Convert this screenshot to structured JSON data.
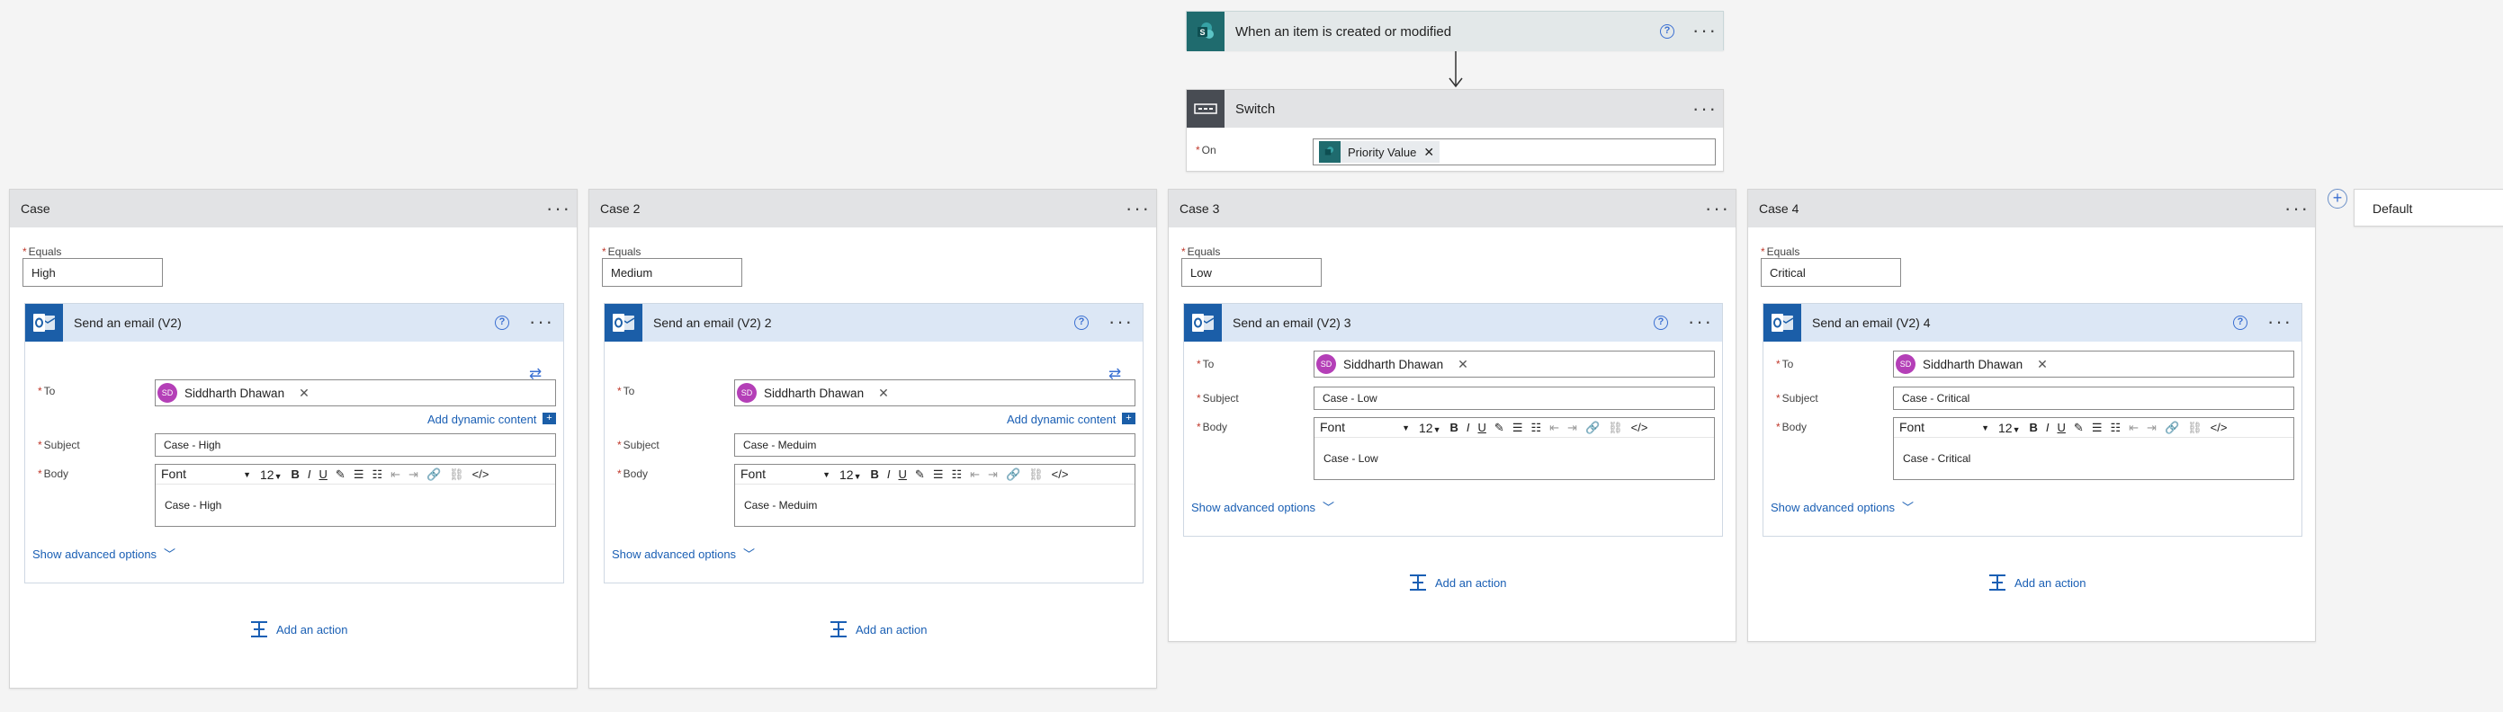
{
  "trigger": {
    "title": "When an item is created or modified",
    "help": "?"
  },
  "switch_card": {
    "title": "Switch",
    "on_label": "On",
    "token": "Priority Value"
  },
  "common": {
    "equals_label": "Equals",
    "to_label": "To",
    "subject_label": "Subject",
    "body_label": "Body",
    "recipient": "Siddharth Dhawan",
    "recipient_initials": "SD",
    "add_dynamic": "Add dynamic content",
    "font": "Font",
    "font_size": "12",
    "advanced": "Show advanced options",
    "add_action": "Add an action",
    "more": "···",
    "help": "?"
  },
  "cases": [
    {
      "title": "Case",
      "equals": "High",
      "action_title": "Send an email (V2)",
      "subject": "Case - High",
      "body": "Case - High"
    },
    {
      "title": "Case 2",
      "equals": "Medium",
      "action_title": "Send an email (V2) 2",
      "subject": "Case - Meduim",
      "body": "Case - Meduim"
    },
    {
      "title": "Case 3",
      "equals": "Low",
      "action_title": "Send an email (V2) 3",
      "subject": "Case - Low",
      "body": "Case - Low"
    },
    {
      "title": "Case 4",
      "equals": "Critical",
      "action_title": "Send an email (V2) 4",
      "subject": "Case - Critical",
      "body": "Case - Critical"
    }
  ],
  "default_card": {
    "title": "Default"
  },
  "colors": {
    "accent": "#1a5fb4",
    "outlook": "#1b5ea8",
    "sharepoint": "#1f6b6e",
    "avatar": "#b43fb7",
    "header": "#e2e3e5"
  }
}
